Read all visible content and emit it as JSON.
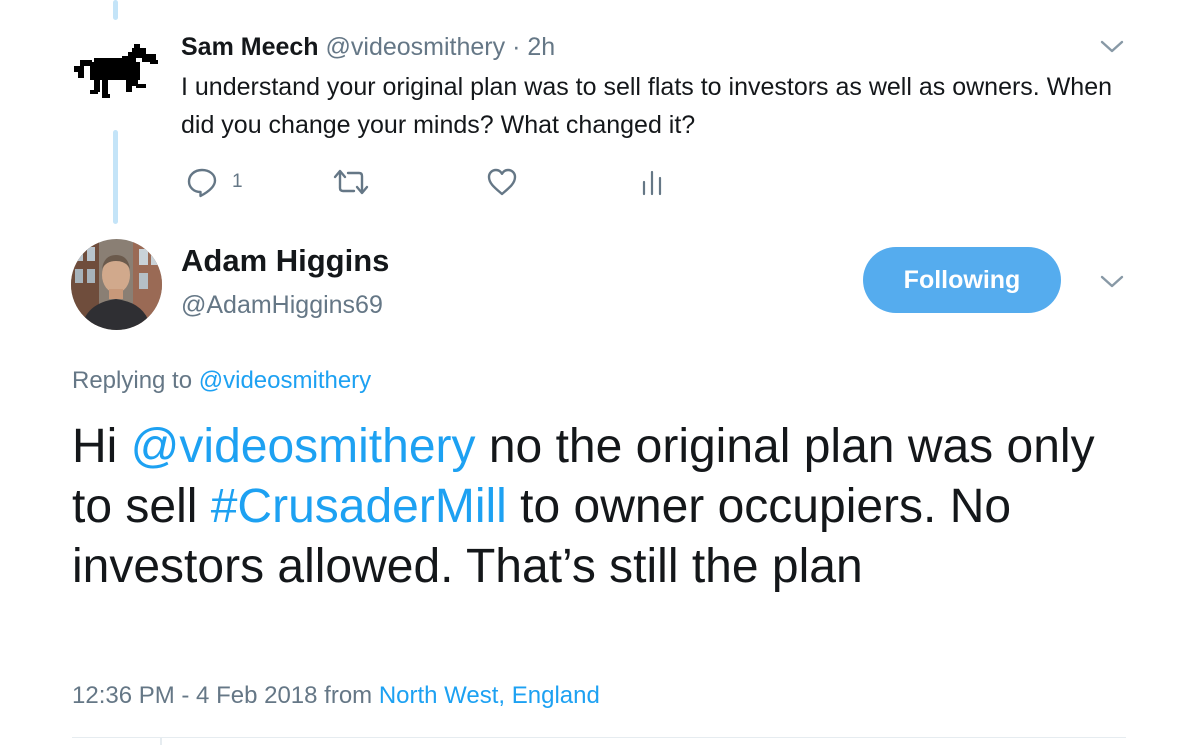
{
  "reply_tweet": {
    "name": "Sam Meech",
    "handle": "@videosmithery",
    "time": "· 2h",
    "text": "I understand your original plan was to sell flats to investors as well as owners. When did you change your minds? What changed it?",
    "reply_count": "1",
    "icons": [
      "reply-icon",
      "retweet-icon",
      "like-icon",
      "analytics-icon",
      "chevron-down-icon"
    ]
  },
  "main_tweet": {
    "name": "Adam Higgins",
    "handle": "@AdamHiggins69",
    "follow_label": "Following",
    "replying_prefix": "Replying to",
    "replying_to": "@videosmithery",
    "text_parts": {
      "p1": "Hi ",
      "mention": "@videosmithery",
      "p2": " no the original plan was only to sell ",
      "hashtag": "#CrusaderMill",
      "p3": " to owner occupiers. No investors allowed. That’s still the plan"
    },
    "timestamp": "12:36 PM - 4 Feb 2018 from",
    "location": "North West, England"
  },
  "colors": {
    "link": "#1da1f2",
    "button": "#55acee",
    "muted": "#657786",
    "thread_line": "#c4e4f8"
  }
}
